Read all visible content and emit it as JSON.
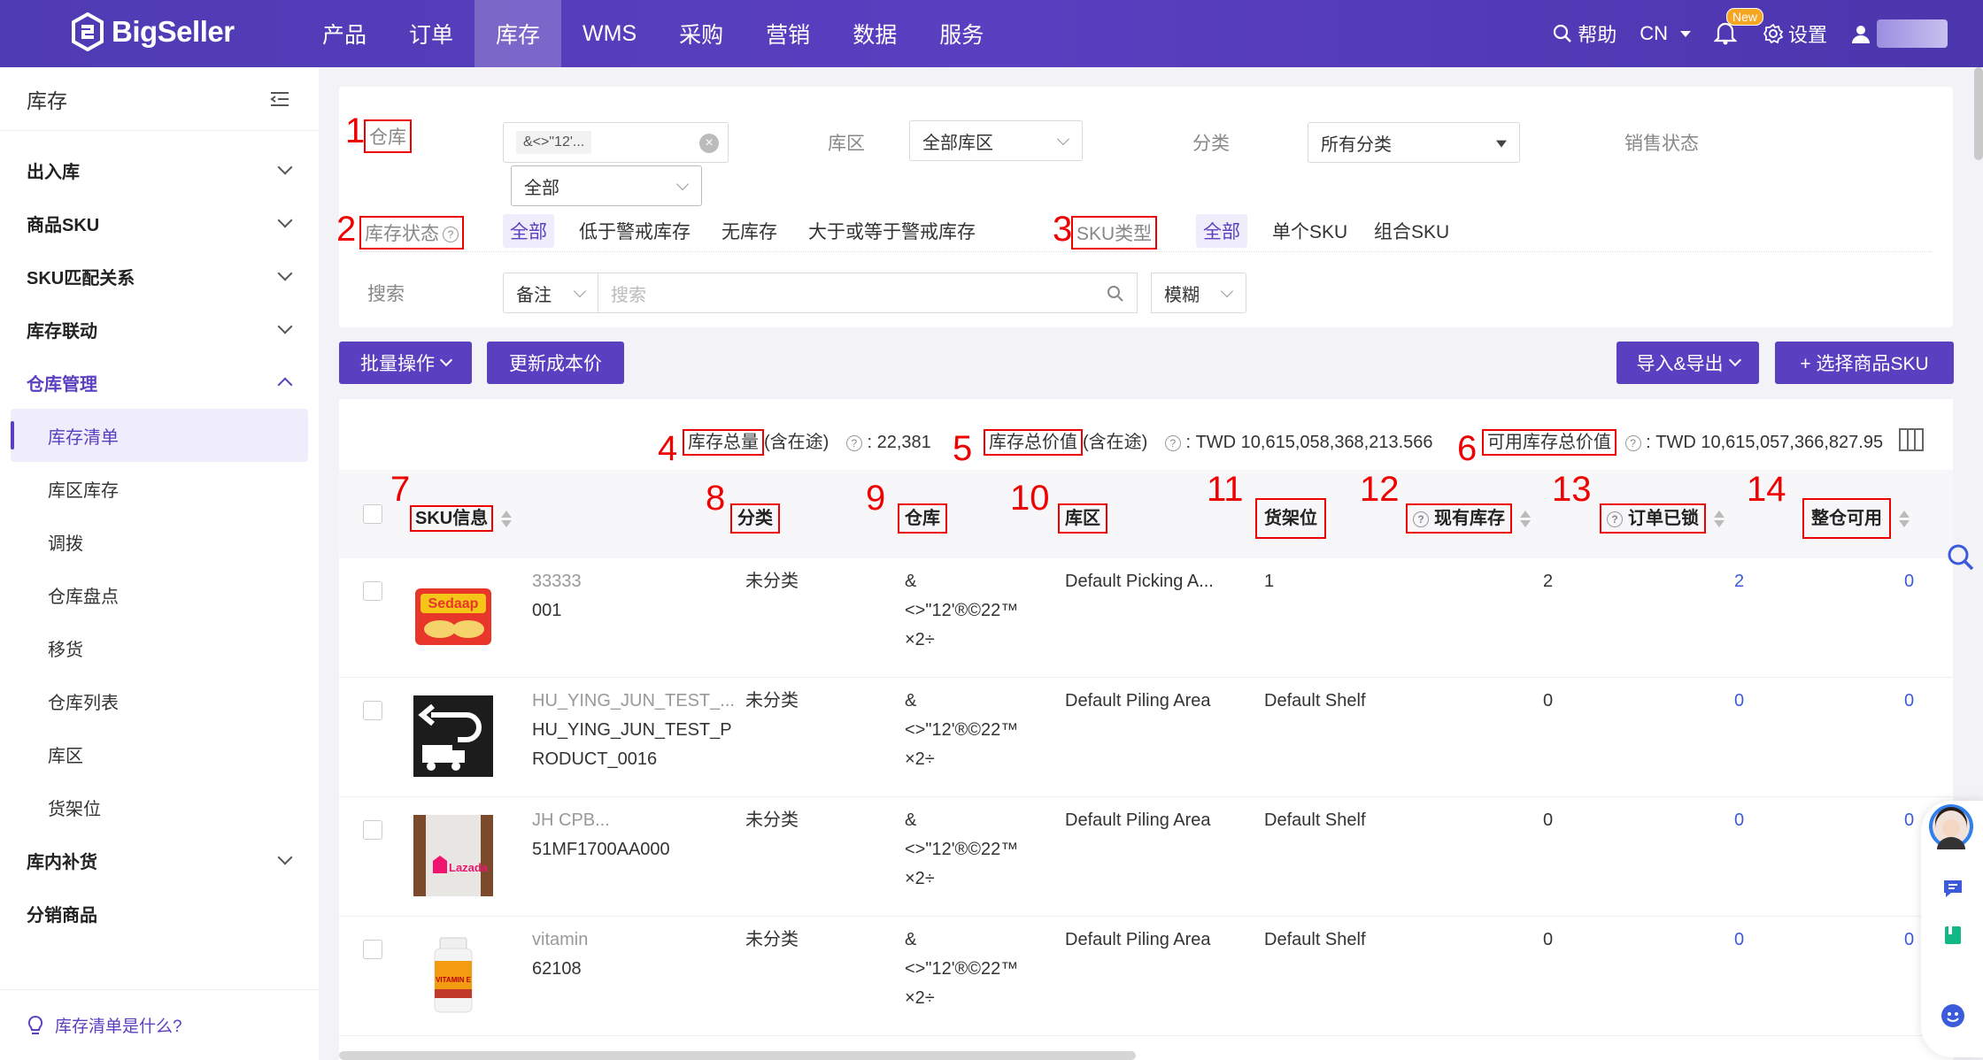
{
  "brand": {
    "name": "BigSeller"
  },
  "nav": {
    "items": [
      "产品",
      "订单",
      "库存",
      "WMS",
      "采购",
      "营销",
      "数据",
      "服务"
    ],
    "active_index": 2
  },
  "topright": {
    "help": "帮助",
    "lang": "CN",
    "new_badge": "New",
    "settings": "设置"
  },
  "sidebar": {
    "title": "库存",
    "groups": [
      {
        "label": "出入库"
      },
      {
        "label": "商品SKU"
      },
      {
        "label": "SKU匹配关系"
      },
      {
        "label": "库存联动"
      },
      {
        "label": "仓库管理"
      },
      {
        "label": "库内补货"
      },
      {
        "label": "分销商品"
      }
    ],
    "subitems": [
      "库存清单",
      "库区库存",
      "调拨",
      "仓库盘点",
      "移货",
      "仓库列表",
      "库区",
      "货架位"
    ],
    "active_sub": 0,
    "footer": "库存清单是什么?"
  },
  "filter": {
    "warehouse_label": "仓库",
    "warehouse_tag": "&<>\"12'...",
    "warehouse_select": "全部",
    "zone_label": "库区",
    "zone_select": "全部库区",
    "category_label": "分类",
    "category_select": "所有分类",
    "sales_status_label": "销售状态",
    "stock_status_label": "库存状态",
    "stock_status_options": [
      "全部",
      "低于警戒库存",
      "无库存",
      "大于或等于警戒库存"
    ],
    "sku_type_label": "SKU类型",
    "sku_type_options": [
      "全部",
      "单个SKU",
      "组合SKU"
    ],
    "search_label": "搜索",
    "search_field": "备注",
    "search_placeholder": "搜索",
    "match_mode": "模糊"
  },
  "toolbar": {
    "batch": "批量操作",
    "update_cost": "更新成本价",
    "import_export": "导入&导出",
    "select_sku": "+ 选择商品SKU"
  },
  "summary": {
    "total_qty_label": "库存总量",
    "in_transit": "(含在途)",
    "total_qty_value": ":   22,381",
    "total_value_label": "库存总价值",
    "total_value_value": ":   TWD 10,615,058,368,213.566",
    "avail_value_label": "可用库存总价值",
    "avail_value_value": ":   TWD 10,615,057,366,827.95"
  },
  "annotations": [
    "1",
    "2",
    "3",
    "4",
    "5",
    "6",
    "7",
    "8",
    "9",
    "10",
    "11",
    "12",
    "13",
    "14"
  ],
  "table": {
    "headers": {
      "sku_info": "SKU信息",
      "category": "分类",
      "warehouse": "仓库",
      "zone": "库区",
      "shelf": "货架位",
      "on_hand": "现有库存",
      "locked": "订单已锁",
      "available": "整仓可用"
    },
    "rows": [
      {
        "sku_name": "33333",
        "sku_code": "001",
        "sku_code2": "",
        "category": "未分类",
        "wh1": "&",
        "wh2": "<>\"12'®©22™",
        "wh3": "×2÷",
        "zone": "Default Picking A...",
        "shelf": "1",
        "on_hand": "2",
        "locked": "2",
        "available": "0"
      },
      {
        "sku_name": "HU_YING_JUN_TEST_...",
        "sku_code": "HU_YING_JUN_TEST_P",
        "sku_code2": "RODUCT_0016",
        "category": "未分类",
        "wh1": "&",
        "wh2": "<>\"12'®©22™",
        "wh3": "×2÷",
        "zone": "Default Piling Area",
        "shelf": "Default Shelf",
        "on_hand": "0",
        "locked": "0",
        "available": "0"
      },
      {
        "sku_name": "JH CPB...",
        "sku_code": "51MF1700AA000",
        "sku_code2": "",
        "category": "未分类",
        "wh1": "&",
        "wh2": "<>\"12'®©22™",
        "wh3": "×2÷",
        "zone": "Default Piling Area",
        "shelf": "Default Shelf",
        "on_hand": "0",
        "locked": "0",
        "available": "0"
      },
      {
        "sku_name": "vitamin",
        "sku_code": "62108",
        "sku_code2": "",
        "category": "未分类",
        "wh1": "&",
        "wh2": "<>\"12'®©22™",
        "wh3": "×2÷",
        "zone": "Default Piling Area",
        "shelf": "Default Shelf",
        "on_hand": "0",
        "locked": "0",
        "available": "0"
      }
    ],
    "thumb_texts": {
      "lazada": "Lazada",
      "sedaap": "Sedaap",
      "vitamin_e": "VITAMIN E"
    }
  },
  "colors": {
    "brand": "#5a3fc0",
    "annotation": "#e00000",
    "link": "#3b5bdb"
  }
}
